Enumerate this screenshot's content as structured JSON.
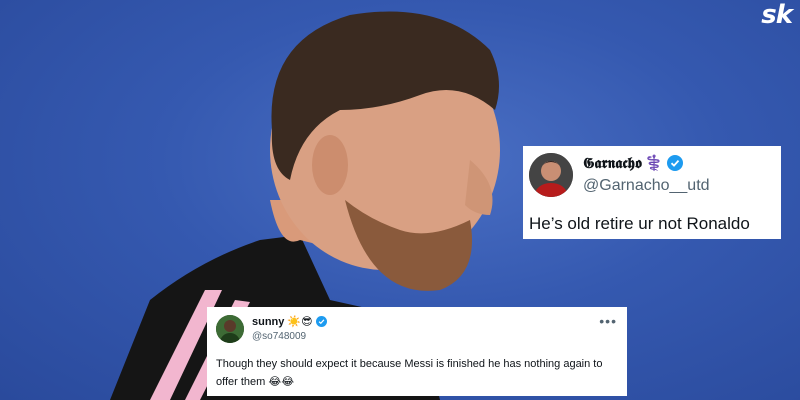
{
  "logo": {
    "text": "sk"
  },
  "tweets": [
    {
      "name": "𝕲𝖆𝖗𝖓𝖆𝖈𝖍𝖔",
      "name_emoji": "⚕️",
      "handle": "@Garnacho__utd",
      "verified": true,
      "text": "He’s old retire ur not Ronaldo"
    },
    {
      "name": "sunny",
      "name_emoji": "☀️😎",
      "handle": "@so748009",
      "verified": true,
      "more": "•••",
      "text": "Though they should expect it because Messi is finished he has nothing again to offer them 😂😂"
    }
  ],
  "colors": {
    "background": "#3559b0",
    "verified": "#1d9bf0",
    "handle": "#536471"
  },
  "icons": [
    "verified-badge-icon",
    "more-options-icon"
  ]
}
